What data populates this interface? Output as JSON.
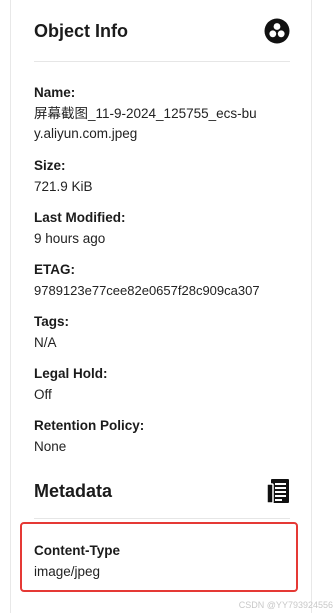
{
  "object_info": {
    "title": "Object Info",
    "icon": "object-info-icon",
    "fields": [
      {
        "label": "Name:",
        "value": "屏幕截图_11-9-2024_125755_ecs-buy.aliyun.com.jpeg"
      },
      {
        "label": "Size:",
        "value": "721.9 KiB"
      },
      {
        "label": "Last Modified:",
        "value": "9 hours ago"
      },
      {
        "label": "ETAG:",
        "value": "9789123e77cee82e0657f28c909ca307"
      },
      {
        "label": "Tags:",
        "value": "N/A"
      },
      {
        "label": "Legal Hold:",
        "value": "Off"
      },
      {
        "label": "Retention Policy:",
        "value": "None"
      }
    ]
  },
  "metadata": {
    "title": "Metadata",
    "icon": "metadata-icon",
    "fields": [
      {
        "label": "Content-Type",
        "value": "image/jpeg"
      }
    ]
  },
  "watermark": "CSDN @YY793924556",
  "colors": {
    "highlight": "#e53935"
  }
}
